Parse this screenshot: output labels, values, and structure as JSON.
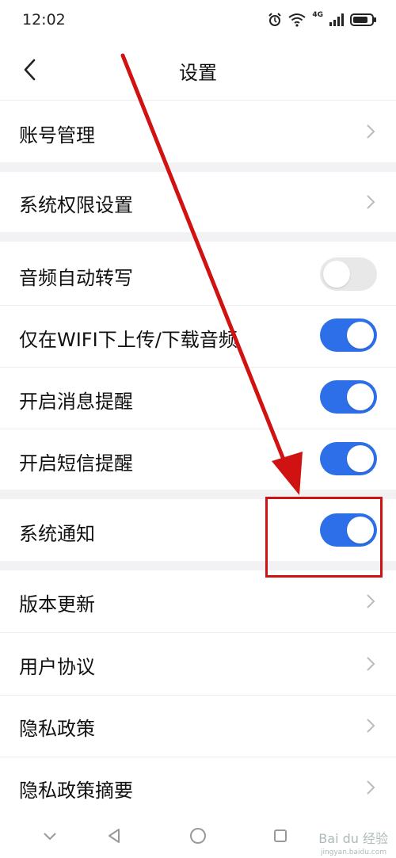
{
  "status_bar": {
    "time": "12:02",
    "network": "4G",
    "icons": [
      "alarm-icon",
      "wifi-icon",
      "signal-icon",
      "battery-icon"
    ]
  },
  "header": {
    "title": "设置",
    "back_icon": "back-chevron-icon"
  },
  "settings": {
    "account": "账号管理",
    "permissions": "系统权限设置",
    "auto_transcribe": {
      "label": "音频自动转写",
      "enabled": false
    },
    "wifi_only": {
      "label": "仅在WIFI下上传/下载音频",
      "enabled": true
    },
    "message_reminder": {
      "label": "开启消息提醒",
      "enabled": true
    },
    "sms_reminder": {
      "label": "开启短信提醒",
      "enabled": true
    },
    "system_notification": {
      "label": "系统通知",
      "enabled": true
    },
    "version_update": "版本更新",
    "user_agreement": "用户协议",
    "privacy_policy": "隐私政策",
    "privacy_summary": "隐私政策摘要"
  },
  "colors": {
    "toggle_on": "#2d6fe8",
    "toggle_off": "#e8e8e8",
    "annotation": "#d11212",
    "section_gap": "#f2f2f5"
  },
  "watermark": {
    "text": "Bai du 经验",
    "sub": "jingyan.baidu.com"
  }
}
